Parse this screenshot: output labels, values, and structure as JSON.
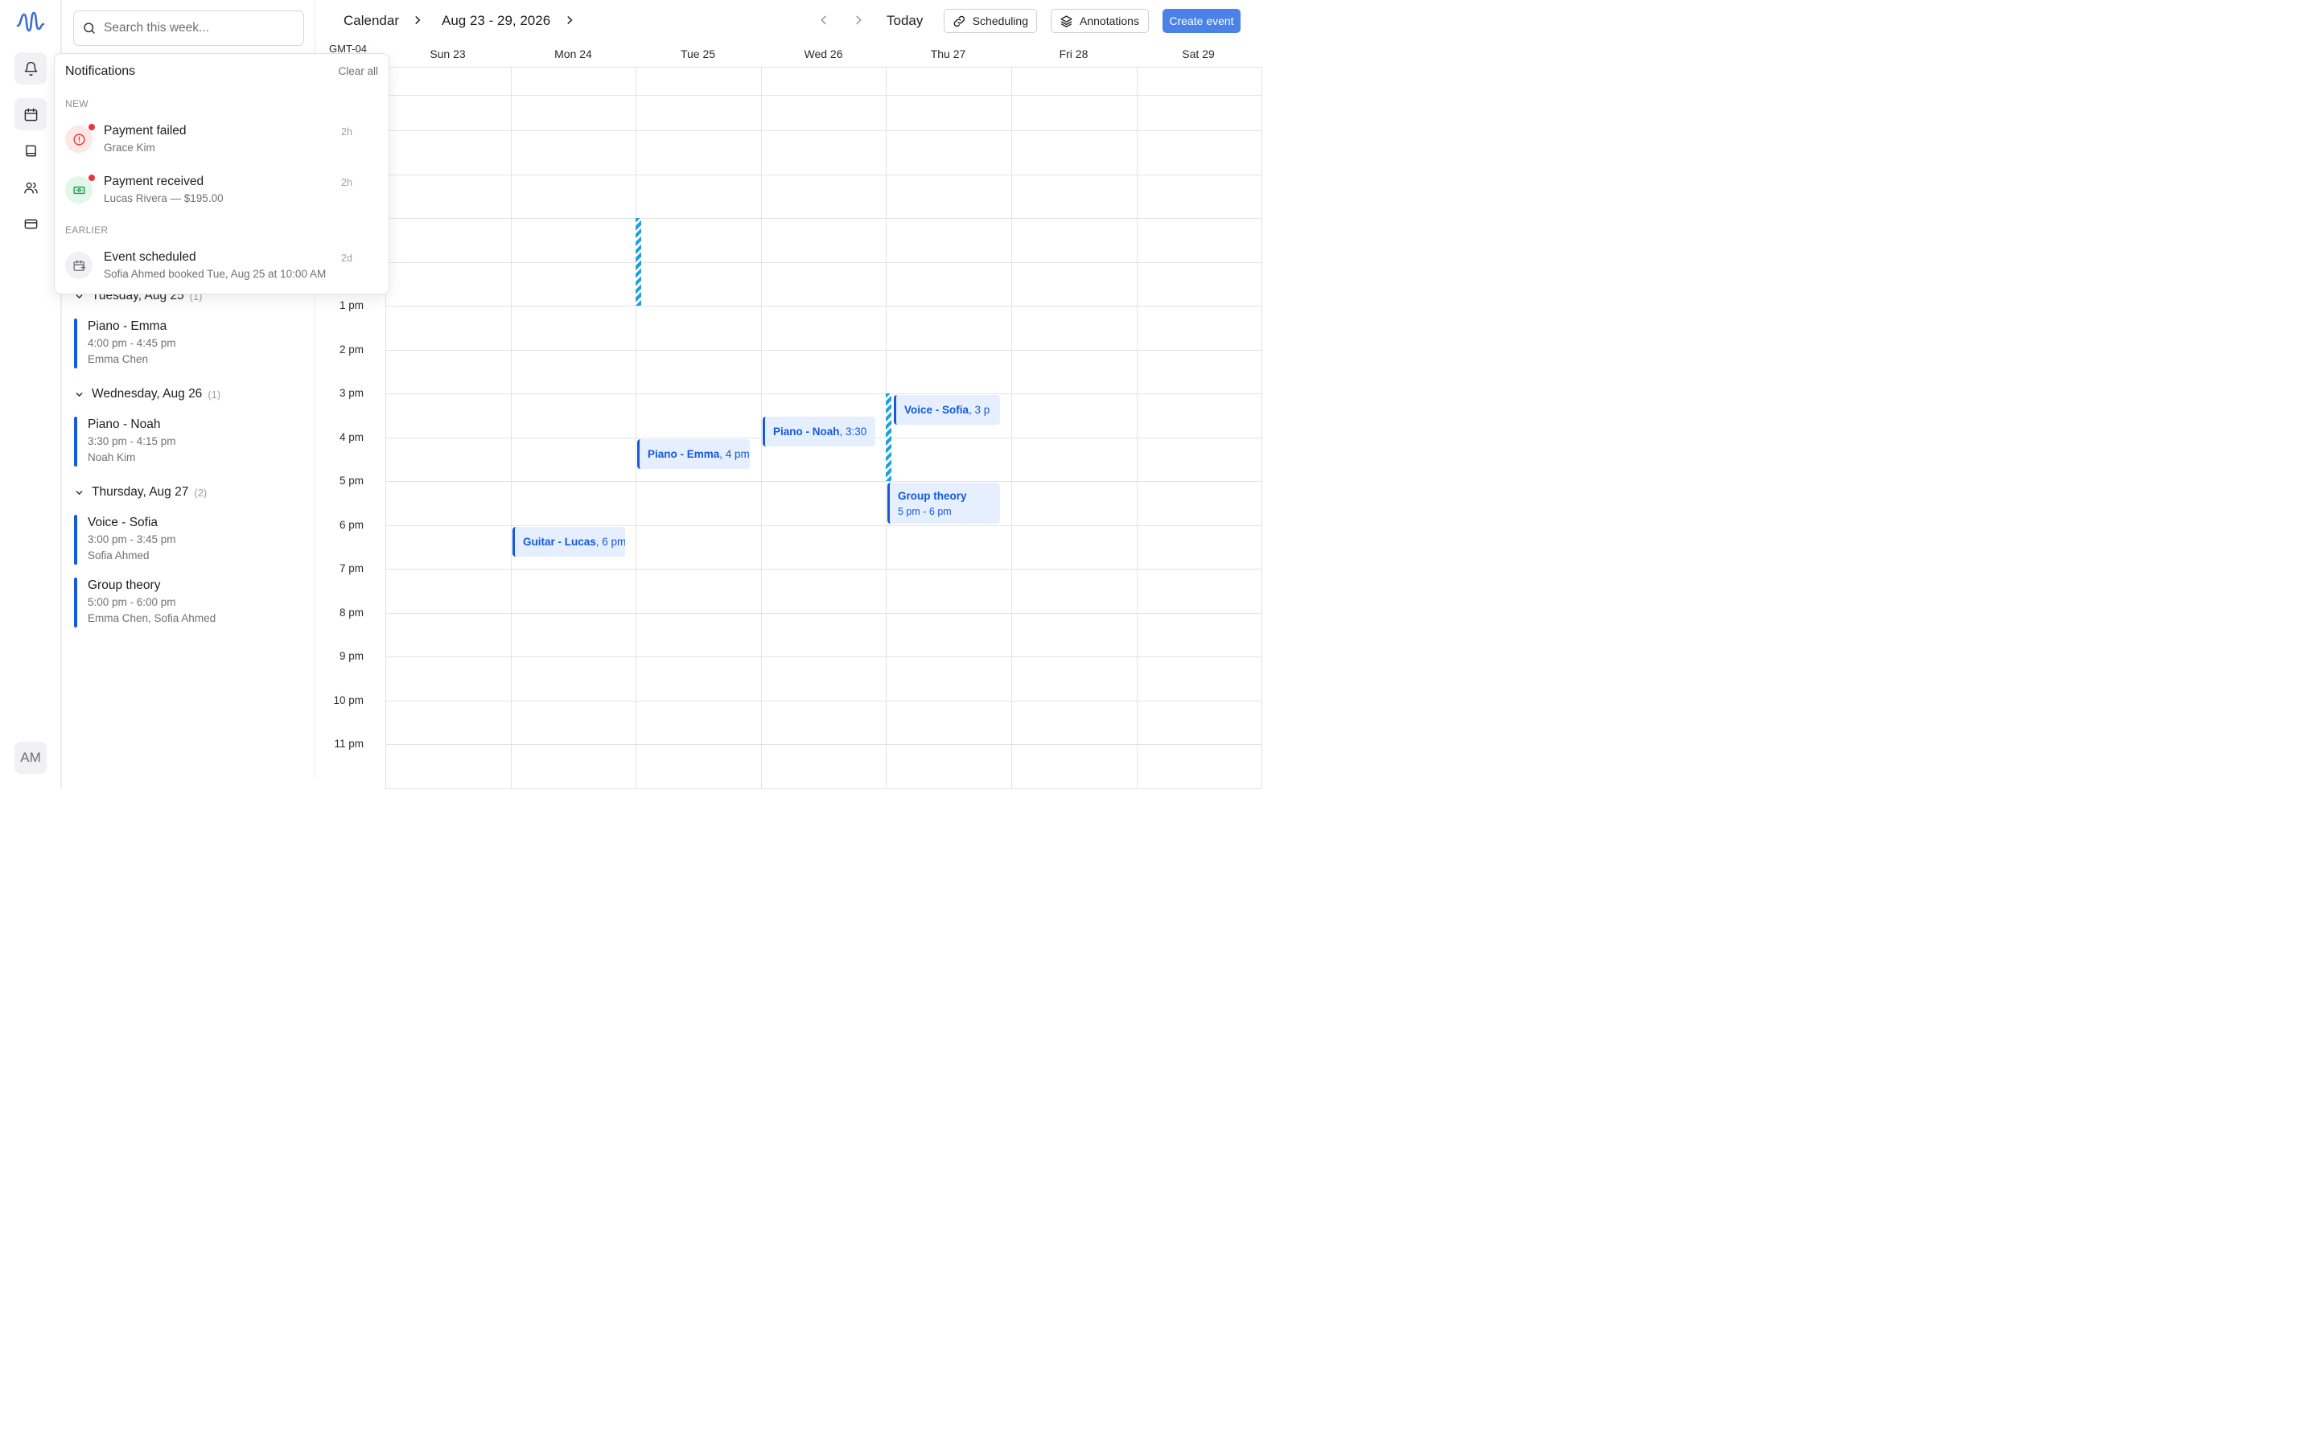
{
  "rail": {
    "items": [
      {
        "name": "bell-icon",
        "active": true
      },
      {
        "name": "calendar-icon",
        "active": true
      },
      {
        "name": "book-icon",
        "active": false
      },
      {
        "name": "users-icon",
        "active": false
      },
      {
        "name": "credit-card-icon",
        "active": false
      }
    ],
    "avatar_initials": "AM"
  },
  "search": {
    "placeholder": "Search this week..."
  },
  "agenda": {
    "days": [
      {
        "label": "Tuesday, Aug 25",
        "count": "(1)",
        "events": [
          {
            "title": "Piano - Emma",
            "time": "4:00 pm - 4:45 pm",
            "who": "Emma Chen"
          }
        ]
      },
      {
        "label": "Wednesday, Aug 26",
        "count": "(1)",
        "events": [
          {
            "title": "Piano - Noah",
            "time": "3:30 pm - 4:15 pm",
            "who": "Noah Kim"
          }
        ]
      },
      {
        "label": "Thursday, Aug 27",
        "count": "(2)",
        "events": [
          {
            "title": "Voice - Sofia",
            "time": "3:00 pm - 3:45 pm",
            "who": "Sofia Ahmed"
          },
          {
            "title": "Group theory",
            "time": "5:00 pm - 6:00 pm",
            "who": "Emma Chen, Sofia Ahmed"
          }
        ]
      }
    ]
  },
  "notifications": {
    "title": "Notifications",
    "clear_label": "Clear all",
    "new_label": "NEW",
    "earlier_label": "EARLIER",
    "new": [
      {
        "title": "Payment failed",
        "subtitle": "Grace Kim",
        "time": "2h",
        "icon": "alert-circle-icon",
        "accent": "#e5383b",
        "unread": true
      },
      {
        "title": "Payment received",
        "subtitle": "Lucas Rivera — $195.00",
        "time": "2h",
        "icon": "banknote-icon",
        "accent": "#1f9d55",
        "unread": true
      }
    ],
    "earlier": [
      {
        "title": "Event scheduled",
        "subtitle": "Sofia Ahmed booked Tue, Aug 25 at 10:00 AM",
        "time": "2d",
        "icon": "calendar-plus-icon",
        "accent": "#707078",
        "unread": false
      }
    ]
  },
  "calendar": {
    "title": "Calendar",
    "range": "Aug 23 - 29, 2026",
    "today_label": "Today",
    "scheduling_label": "Scheduling",
    "annotations_label": "Annotations",
    "create_label": "Create event",
    "timezone": "GMT-04",
    "days": [
      "Sun 23",
      "Mon 24",
      "Tue 25",
      "Wed 26",
      "Thu 27",
      "Fri 28",
      "Sat 29"
    ],
    "hours": [
      "1 pm",
      "2 pm",
      "3 pm",
      "4 pm",
      "5 pm",
      "6 pm",
      "7 pm",
      "8 pm",
      "9 pm",
      "10 pm",
      "11 pm"
    ],
    "events": [
      {
        "day": 2,
        "start": 16.0,
        "end": 16.75,
        "title": "Piano - Emma",
        "time": "4 pm"
      },
      {
        "day": 3,
        "start": 15.5,
        "end": 16.25,
        "title": "Piano - Noah",
        "time": "3:30"
      },
      {
        "day": 4,
        "start": 15.0,
        "end": 15.75,
        "title": "Voice - Sofia",
        "time": "3 p"
      },
      {
        "day": 4,
        "start": 17.0,
        "end": 18.0,
        "title": "Group theory",
        "time": "5 pm - 6 pm"
      },
      {
        "day": 1,
        "start": 18.0,
        "end": 18.75,
        "title": "Guitar - Lucas",
        "time": "6 pm"
      }
    ],
    "accent": "#1559dc",
    "primary": "#4a82e8"
  }
}
